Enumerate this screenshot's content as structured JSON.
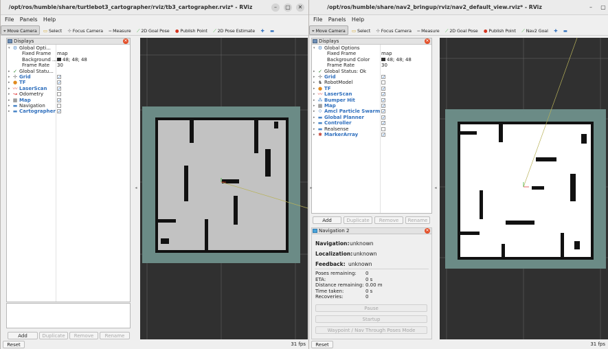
{
  "left": {
    "title": "/opt/ros/humble/share/turtlebot3_cartographer/rviz/tb3_cartographer.rviz* - RViz",
    "menu": [
      "File",
      "Panels",
      "Help"
    ],
    "tools": [
      "Move Camera",
      "Select",
      "Focus Camera",
      "Measure",
      "2D Goal Pose",
      "Publish Point",
      "2D Pose Estimate"
    ],
    "displays": {
      "header": "Displays",
      "items": [
        {
          "label": "Global Opti...",
          "value": "",
          "check": ""
        },
        {
          "label": "Fixed Frame",
          "value": "map",
          "check": ""
        },
        {
          "label": "Background ...",
          "value": "48; 48; 48",
          "check": ""
        },
        {
          "label": "Frame Rate",
          "value": "30",
          "check": ""
        },
        {
          "label": "Global Statu...",
          "value": "",
          "check": ""
        },
        {
          "label": "Grid",
          "value": "",
          "check": "✓"
        },
        {
          "label": "TF",
          "value": "",
          "check": "✓"
        },
        {
          "label": "LaserScan",
          "value": "",
          "check": "✓"
        },
        {
          "label": "Odometry",
          "value": "",
          "check": ""
        },
        {
          "label": "Map",
          "value": "",
          "check": "✓"
        },
        {
          "label": "Navigation",
          "value": "",
          "check": ""
        },
        {
          "label": "Cartographer",
          "value": "",
          "check": "✓"
        }
      ],
      "buttons": [
        "Add",
        "Duplicate",
        "Remove",
        "Rename"
      ]
    },
    "reset": "Reset",
    "fps": "31 fps"
  },
  "right": {
    "title": "/opt/ros/humble/share/nav2_bringup/rviz/nav2_default_view.rviz* - RViz",
    "menu": [
      "File",
      "Panels",
      "Help"
    ],
    "tools": [
      "Move Camera",
      "Select",
      "Focus Camera",
      "Measure",
      "2D Goal Pose",
      "Publish Point",
      "Nav2 Goal"
    ],
    "displays": {
      "header": "Displays",
      "items": [
        {
          "label": "Global Options",
          "value": "",
          "check": ""
        },
        {
          "label": "Fixed Frame",
          "value": "map",
          "check": ""
        },
        {
          "label": "Background Color",
          "value": "48; 48; 48",
          "check": ""
        },
        {
          "label": "Frame Rate",
          "value": "30",
          "check": ""
        },
        {
          "label": "Global Status: Ok",
          "value": "",
          "check": ""
        },
        {
          "label": "Grid",
          "value": "",
          "check": "✓"
        },
        {
          "label": "RobotModel",
          "value": "",
          "check": ""
        },
        {
          "label": "TF",
          "value": "",
          "check": "✓"
        },
        {
          "label": "LaserScan",
          "value": "",
          "check": "✓"
        },
        {
          "label": "Bumper Hit",
          "value": "",
          "check": "✓"
        },
        {
          "label": "Map",
          "value": "",
          "check": "✓"
        },
        {
          "label": "Amcl Particle Swarm",
          "value": "",
          "check": "✓"
        },
        {
          "label": "Global Planner",
          "value": "",
          "check": "✓"
        },
        {
          "label": "Controller",
          "value": "",
          "check": "✓"
        },
        {
          "label": "Realsense",
          "value": "",
          "check": ""
        },
        {
          "label": "MarkerArray",
          "value": "",
          "check": "✓"
        }
      ],
      "buttons": [
        "Add",
        "Duplicate",
        "Remove",
        "Rename"
      ]
    },
    "nav2": {
      "header": "Navigation 2",
      "navigation_label": "Navigation:",
      "navigation_value": "unknown",
      "localization_label": "Localization:",
      "localization_value": "unknown",
      "feedback_label": "Feedback:",
      "feedback_value": "unknown",
      "stats": [
        {
          "label": "Poses remaining:",
          "value": "0"
        },
        {
          "label": "ETA:",
          "value": "0 s"
        },
        {
          "label": "Distance remaining:",
          "value": "0.00 m"
        },
        {
          "label": "Time taken:",
          "value": "0 s"
        },
        {
          "label": "Recoveries:",
          "value": "0"
        }
      ],
      "buttons": [
        "Pause",
        "Startup",
        "Waypoint / Nav Through Poses Mode"
      ]
    },
    "reset": "Reset",
    "fps": "31 fps"
  },
  "colors": {
    "viewport_bg": "#303030",
    "map_frame": "#6b8b86",
    "accent": "#2f6fbd"
  }
}
